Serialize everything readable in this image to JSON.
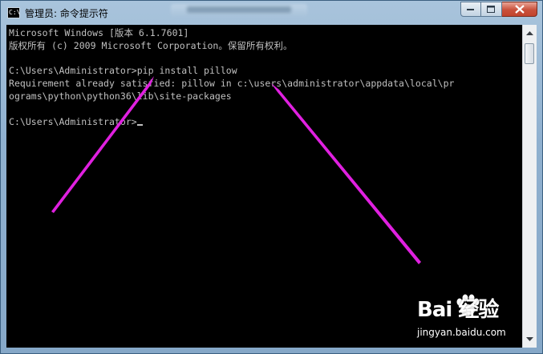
{
  "window": {
    "title": "管理员: 命令提示符",
    "icon_label": "C:\\"
  },
  "console": {
    "lines": [
      "Microsoft Windows [版本 6.1.7601]",
      "版权所有 (c) 2009 Microsoft Corporation。保留所有权利。",
      "",
      "C:\\Users\\Administrator>pip install pillow",
      "Requirement already satisfied: pillow in c:\\users\\administrator\\appdata\\local\\pr",
      "ograms\\python\\python36\\lib\\site-packages",
      "",
      "C:\\Users\\Administrator>"
    ]
  },
  "watermark": {
    "logo": "Bai 经验",
    "url": "jingyan.baidu.com"
  },
  "colors": {
    "console_bg": "#000000",
    "console_text": "#c0c0c0",
    "annotation_arrow": "#e020e0",
    "close_button": "#c9513b"
  }
}
